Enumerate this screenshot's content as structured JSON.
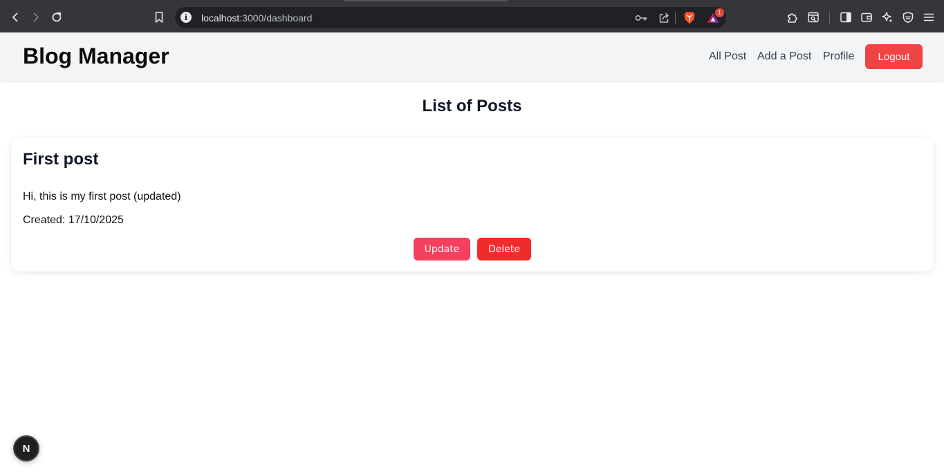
{
  "browser": {
    "url_host": "localhost",
    "url_path": ":3000/dashboard",
    "rewards_count": "1",
    "colors": {
      "chrome_bg": "#35363a",
      "omnibox_bg": "#202124",
      "brave_orange": "#fb542b"
    }
  },
  "header": {
    "brand": "Blog Manager",
    "nav": {
      "all_post": "All Post",
      "add_post": "Add a Post",
      "profile": "Profile"
    },
    "logout_label": "Logout"
  },
  "main": {
    "title": "List of Posts",
    "posts": [
      {
        "title": "First post",
        "body": "Hi, this is my first post (updated)",
        "created": "Created: 17/10/2025",
        "update_label": "Update",
        "delete_label": "Delete"
      }
    ]
  },
  "dev": {
    "next_badge": "N"
  },
  "colors": {
    "header_bg": "#f3f4f6",
    "logout": "#ef4444",
    "update": "#f43f5e",
    "delete": "#ef2b2b"
  }
}
